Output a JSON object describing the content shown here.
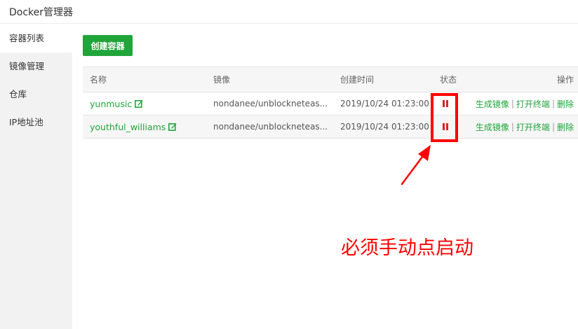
{
  "app": {
    "title": "Docker管理器"
  },
  "sidebar": {
    "items": [
      {
        "label": "容器列表",
        "active": true
      },
      {
        "label": "镜像管理",
        "active": false
      },
      {
        "label": "仓库",
        "active": false
      },
      {
        "label": "IP地址池",
        "active": false
      }
    ]
  },
  "toolbar": {
    "create_label": "创建容器"
  },
  "table": {
    "headers": {
      "name": "名称",
      "image": "镜像",
      "created": "创建时间",
      "status": "状态",
      "ops": "操作"
    },
    "rows": [
      {
        "name": "yunmusic",
        "image": "nondanee/unblockneteas...",
        "created": "2019/10/24 01:23:00",
        "status_icon": "pause-icon",
        "ops": {
          "make_image": "生成镜像",
          "open_terminal": "打开终端",
          "delete": "删除",
          "sep": "|"
        }
      },
      {
        "name": "youthful_williams",
        "image": "nondanee/unblockneteas...",
        "created": "2019/10/24 01:23:00",
        "status_icon": "pause-icon",
        "ops": {
          "make_image": "生成镜像",
          "open_terminal": "打开终端",
          "delete": "删除",
          "sep": "|"
        }
      }
    ]
  },
  "annotation": {
    "text": "必须手动点启动",
    "color": "#ff0000"
  },
  "colors": {
    "accent": "#20a53a",
    "status": "#e02020",
    "annotation": "#ff0000"
  }
}
